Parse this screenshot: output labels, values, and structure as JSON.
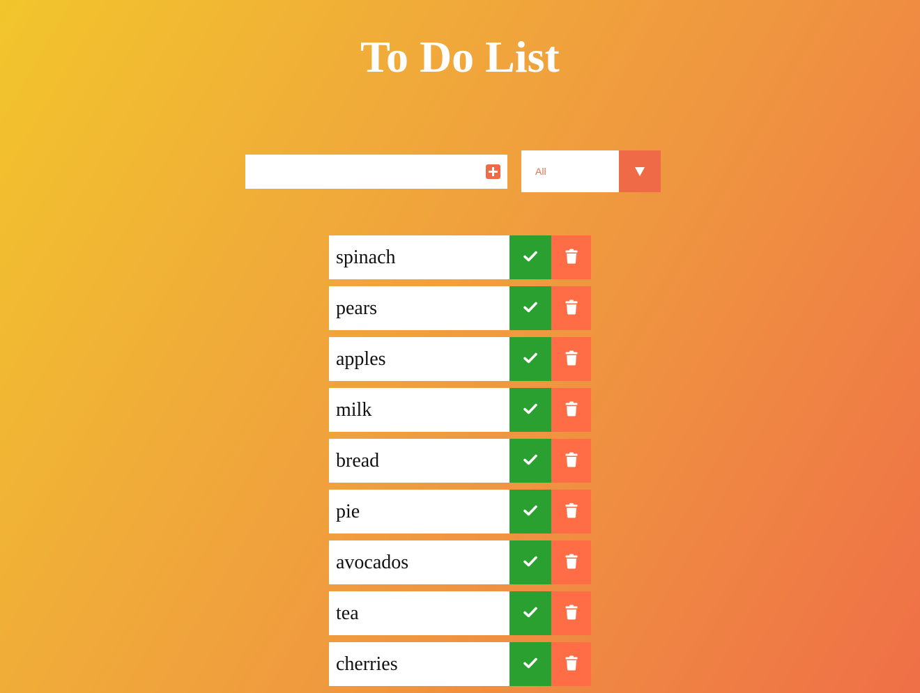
{
  "app": {
    "title": "To Do List"
  },
  "add_form": {
    "input_value": "",
    "input_placeholder": "",
    "add_icon": "plus-square-icon"
  },
  "filter": {
    "selected": "All",
    "arrow_icon": "triangle-down-icon"
  },
  "todos": [
    {
      "text": "spinach"
    },
    {
      "text": "pears"
    },
    {
      "text": "apples"
    },
    {
      "text": "milk"
    },
    {
      "text": "bread"
    },
    {
      "text": "pie"
    },
    {
      "text": "avocados"
    },
    {
      "text": "tea"
    },
    {
      "text": "cherries"
    }
  ],
  "item_icons": {
    "complete": "check-icon",
    "delete": "trash-icon"
  },
  "colors": {
    "accent": "#ef6b47",
    "complete": "#29a02f",
    "delete": "#fe6d45",
    "gradient_start": "#f2c52c",
    "gradient_end": "#ef6f47"
  }
}
